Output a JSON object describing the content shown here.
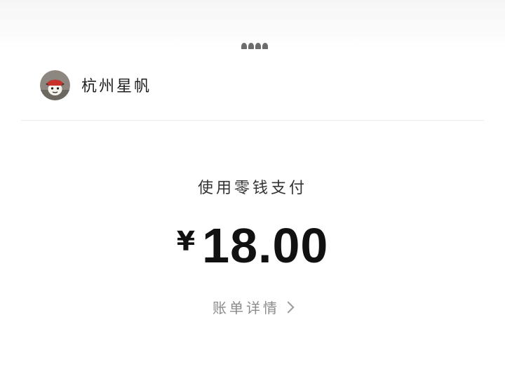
{
  "header": {
    "merchant_name": "杭州星帆",
    "avatar_icon": "cartoon-avatar-icon"
  },
  "payment": {
    "method_label": "使用零钱支付",
    "currency_symbol": "¥",
    "amount": "18.00"
  },
  "details": {
    "link_label": "账单详情",
    "chevron_icon": "chevron-right-icon"
  },
  "colors": {
    "background": "#ffffff",
    "text_primary": "#111111",
    "text_secondary": "#8a8a8a",
    "divider": "#ececec"
  }
}
